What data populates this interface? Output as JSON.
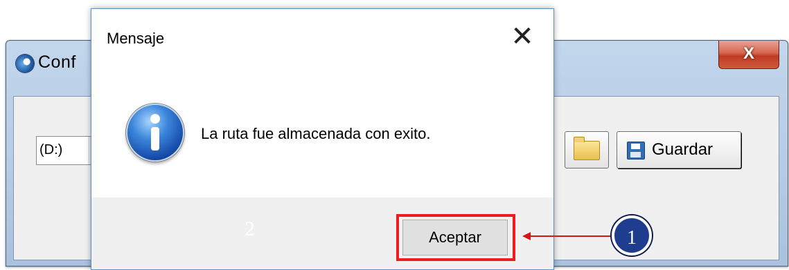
{
  "background_window": {
    "title_partial": "Conf",
    "close_glyph": "X",
    "path_value": "(D:)",
    "folder_icon": "folder-icon",
    "save_icon": "floppy-disk-icon",
    "save_label": "Guardar"
  },
  "dialog": {
    "title": "Mensaje",
    "close_glyph": "✕",
    "icon": "info-icon",
    "message": "La ruta fue almacenada con exito.",
    "footer_number": "2",
    "accept_label": "Aceptar"
  },
  "annotation": {
    "step_number": "1",
    "highlight_color": "#ee1c1c",
    "badge_color": "#1f3d8f"
  }
}
